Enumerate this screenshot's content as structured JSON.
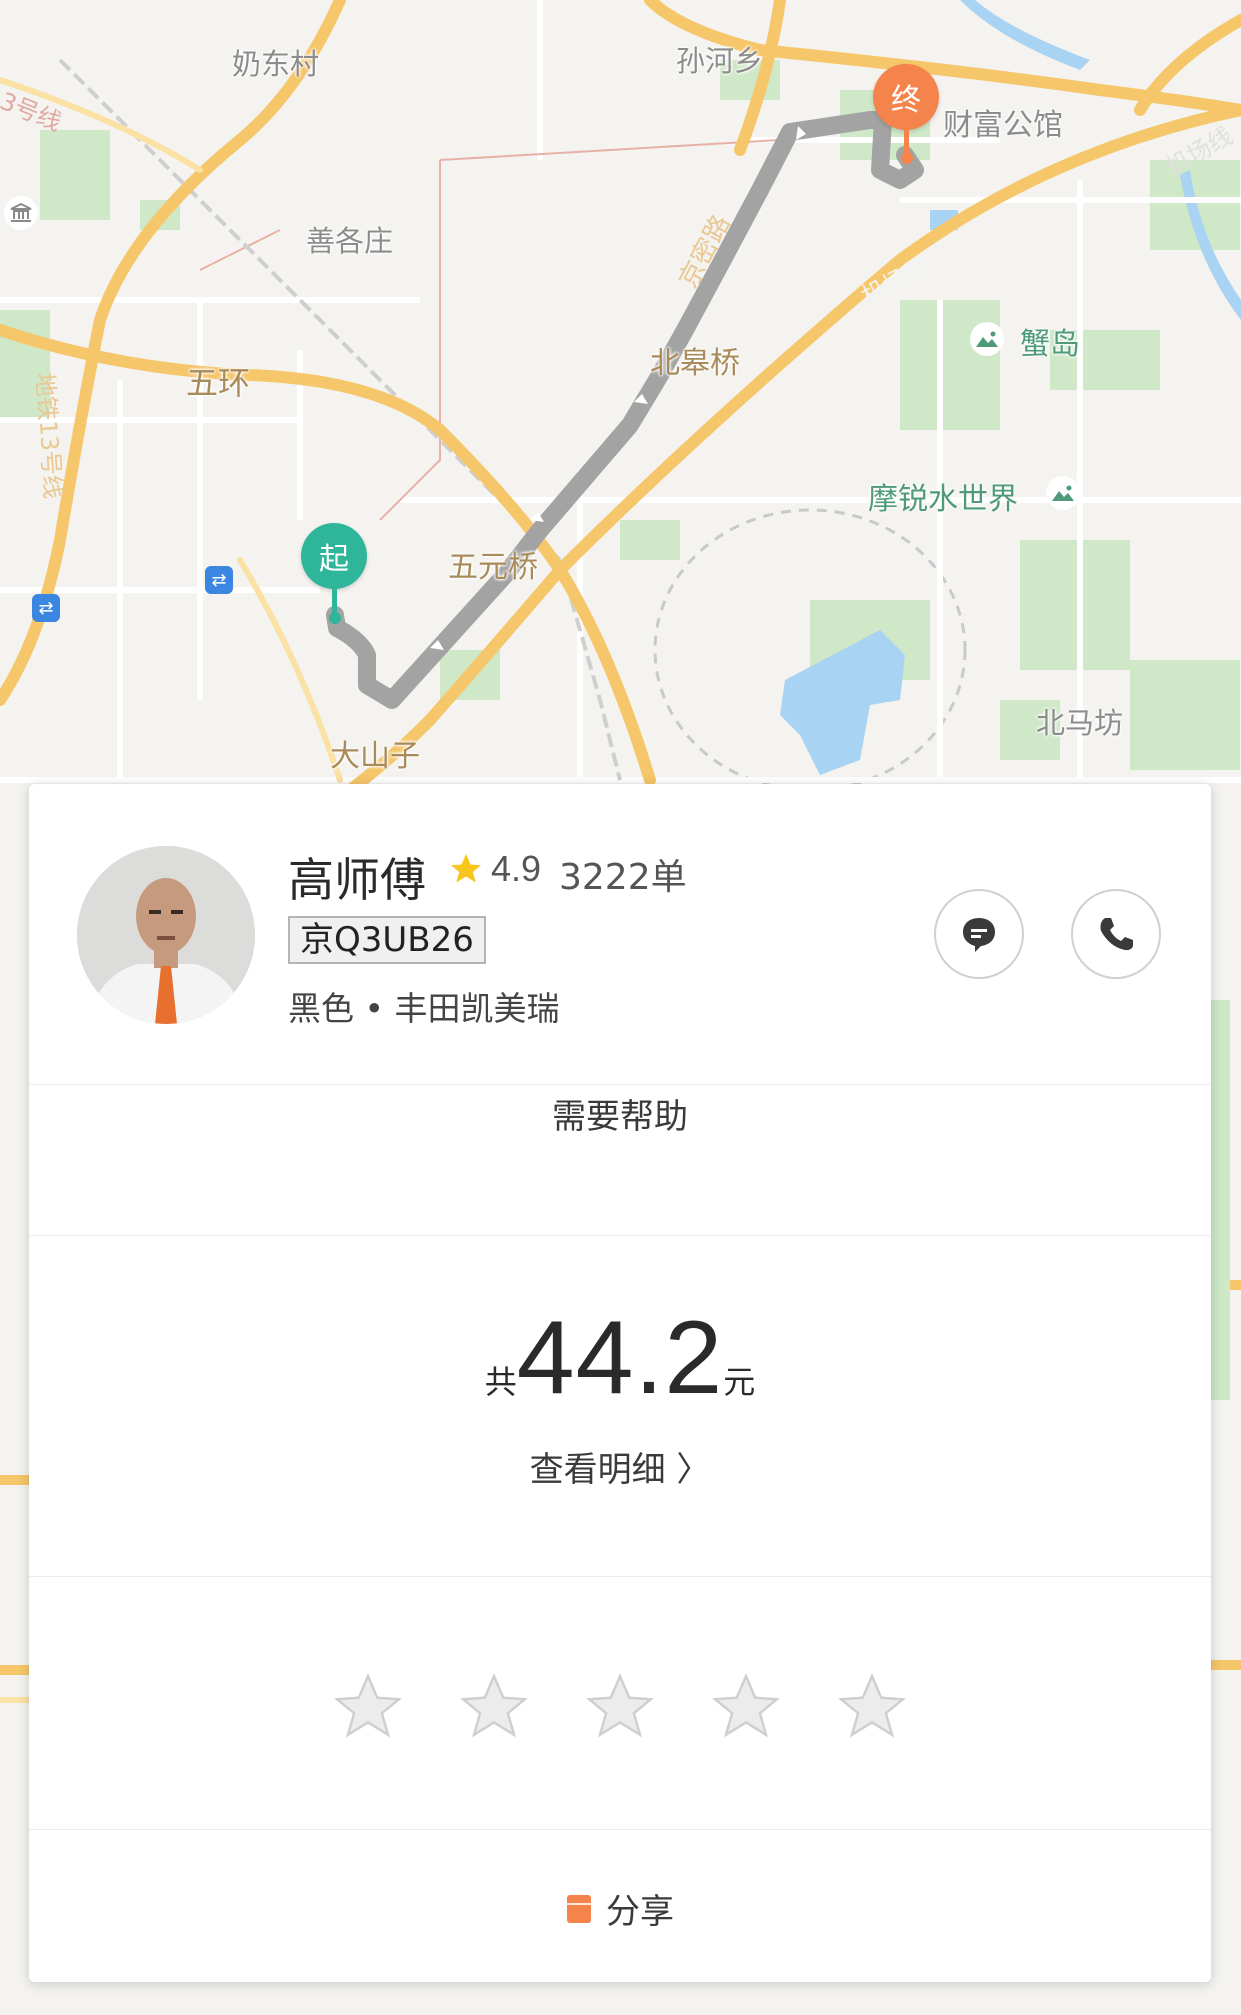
{
  "map": {
    "place_labels": {
      "naidongcun": "奶东村",
      "sunhexiang": "孙河乡",
      "caifugongguan": "财富公馆",
      "shangezhuang": "善各庄",
      "wuhuan": "五环",
      "beigaoqiao": "北皋桥",
      "xiedao": "蟹岛",
      "moruishuishijie": "摩锐水世界",
      "wuyuanqiao": "五元桥",
      "beimafang": "北马坊",
      "dashanzi": "大山子"
    },
    "road_labels": {
      "line3": "3号线",
      "jichangxian_right": "机场线",
      "jichangxian": "机场线",
      "jingmilu": "京密路",
      "metro13": "地铁13号线"
    },
    "start_pin": "起",
    "end_pin": "终",
    "route_color": "#a9a9a9",
    "start_color": "#2fb59a",
    "end_color": "#f5834c"
  },
  "driver": {
    "name": "高师傅",
    "rating": "4.9",
    "orders": "3222单",
    "plate": "京Q3UB26",
    "car": "黑色 • 丰田凯美瑞"
  },
  "actions": {
    "message_icon": "chat-bubble-icon",
    "phone_icon": "phone-icon"
  },
  "help": {
    "label": "需要帮助"
  },
  "fare": {
    "prefix": "共",
    "amount": "44.2",
    "unit": "元",
    "details_label": "查看明细 〉"
  },
  "rating": {
    "stars": 5
  },
  "share": {
    "label": "分享",
    "icon_color": "#f5834c"
  }
}
